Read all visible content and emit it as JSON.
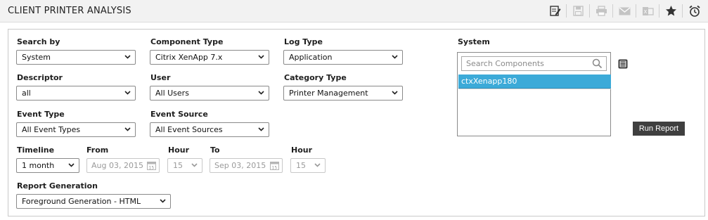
{
  "header": {
    "title": "CLIENT PRINTER ANALYSIS",
    "icons": [
      "edit-icon",
      "save-icon",
      "print-icon",
      "email-icon",
      "export-icon",
      "favorite-icon",
      "alarm-icon"
    ]
  },
  "form": {
    "search_by": {
      "label": "Search by",
      "value": "System"
    },
    "component_type": {
      "label": "Component Type",
      "value": "Citrix XenApp 7.x"
    },
    "log_type": {
      "label": "Log Type",
      "value": "Application"
    },
    "descriptor": {
      "label": "Descriptor",
      "value": "all"
    },
    "user": {
      "label": "User",
      "value": "All Users"
    },
    "category_type": {
      "label": "Category Type",
      "value": "Printer Management"
    },
    "event_type": {
      "label": "Event Type",
      "value": "All Event Types"
    },
    "event_source": {
      "label": "Event Source",
      "value": "All Event Sources"
    },
    "timeline": {
      "label": "Timeline",
      "value": "1 month"
    },
    "from": {
      "label": "From",
      "date": "Aug 03, 2015",
      "hour_label": "Hour",
      "hour": "15"
    },
    "to": {
      "label": "To",
      "date": "Sep 03, 2015",
      "hour_label": "Hour",
      "hour": "15"
    },
    "report_generation": {
      "label": "Report Generation",
      "value": "Foreground Generation - HTML"
    }
  },
  "system": {
    "label": "System",
    "search_placeholder": "Search Components",
    "items": [
      "ctxXenapp180"
    ]
  },
  "run_button": "Run Report",
  "colors": {
    "accent": "#3caad8",
    "button": "#3f3f3f"
  }
}
